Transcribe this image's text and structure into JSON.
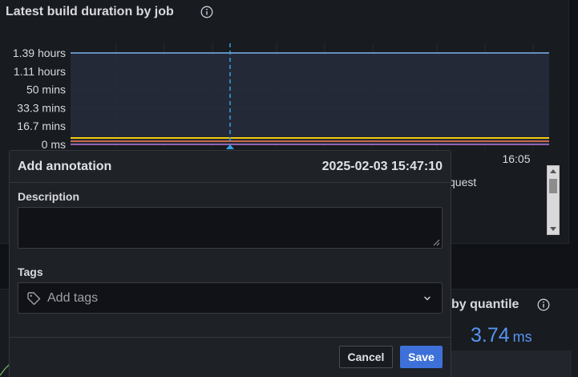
{
  "top_panel": {
    "title": "Latest build duration by job",
    "legend_partial": "quest"
  },
  "chart_data": {
    "type": "line",
    "y_tick_labels": [
      "1.39 hours",
      "1.11 hours",
      "50 mins",
      "33.3 mins",
      "16.7 mins",
      "0 ms"
    ],
    "x_tick_labels": [
      "16:05"
    ],
    "series_colors": [
      "#7eb2f0",
      "#f2cc0c",
      "#ff7f4f",
      "#b877d9"
    ]
  },
  "annotation": {
    "title": "Add annotation",
    "timestamp": "2025-02-03 15:47:10",
    "description_label": "Description",
    "description_value": "",
    "tags_label": "Tags",
    "tags_placeholder": "Add tags",
    "cancel_label": "Cancel",
    "save_label": "Save"
  },
  "bottom_panel": {
    "title_partial": "by quantile",
    "stat_value": "3.74",
    "stat_unit": "ms"
  },
  "colors": {
    "accent": "#3d71d9",
    "stat": "#5794f2",
    "marker": "#33a2e5"
  }
}
